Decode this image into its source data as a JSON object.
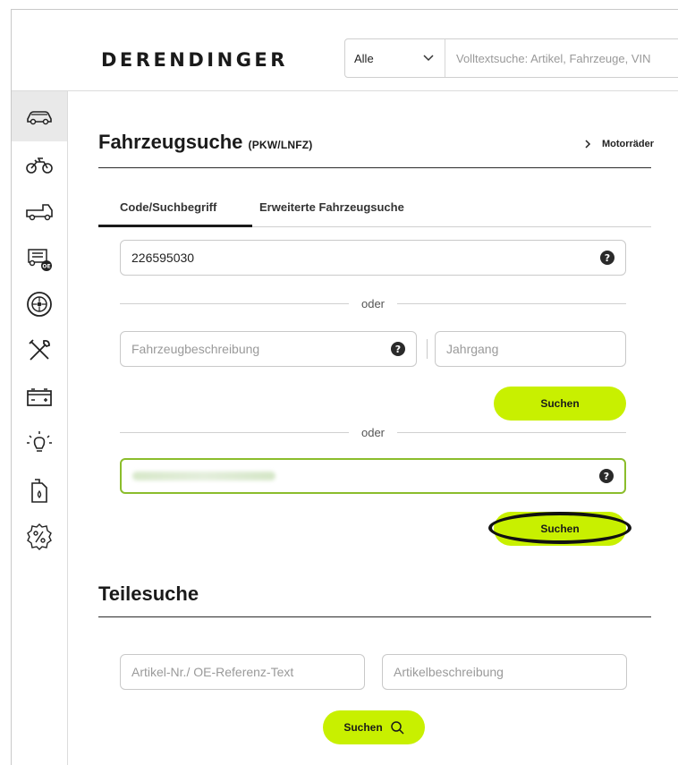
{
  "header": {
    "logo": "DERENDINGER",
    "search_select": "Alle",
    "search_placeholder": "Volltextsuche: Artikel, Fahrzeuge, VIN"
  },
  "sidebar": {
    "items": [
      {
        "icon": "car-icon",
        "active": true
      },
      {
        "icon": "motorcycle-icon"
      },
      {
        "icon": "truck-icon"
      },
      {
        "icon": "oe-vehicle-icon"
      },
      {
        "icon": "tire-icon"
      },
      {
        "icon": "tools-icon"
      },
      {
        "icon": "battery-icon"
      },
      {
        "icon": "lightbulb-icon"
      },
      {
        "icon": "oil-canister-icon"
      },
      {
        "icon": "percent-badge-icon"
      }
    ]
  },
  "vehicle_search": {
    "title": "Fahrzeugsuche",
    "title_suffix": "(PKW/LNFZ)",
    "motorcycle_link": "Motorräder",
    "tabs": [
      "Code/Suchbegriff",
      "Erweiterte Fahrzeugsuche"
    ],
    "code_value": "226595030",
    "or_label": "oder",
    "description_placeholder": "Fahrzeugbeschreibung",
    "year_placeholder": "Jahrgang",
    "search_button": "Suchen",
    "search_button_2": "Suchen"
  },
  "parts_search": {
    "title": "Teilesuche",
    "article_placeholder": "Artikel-Nr./ OE-Referenz-Text",
    "description_placeholder": "Artikelbeschreibung",
    "search_button": "Suchen"
  },
  "colors": {
    "accent": "#c8f000",
    "active_border": "#8bbd2b"
  }
}
